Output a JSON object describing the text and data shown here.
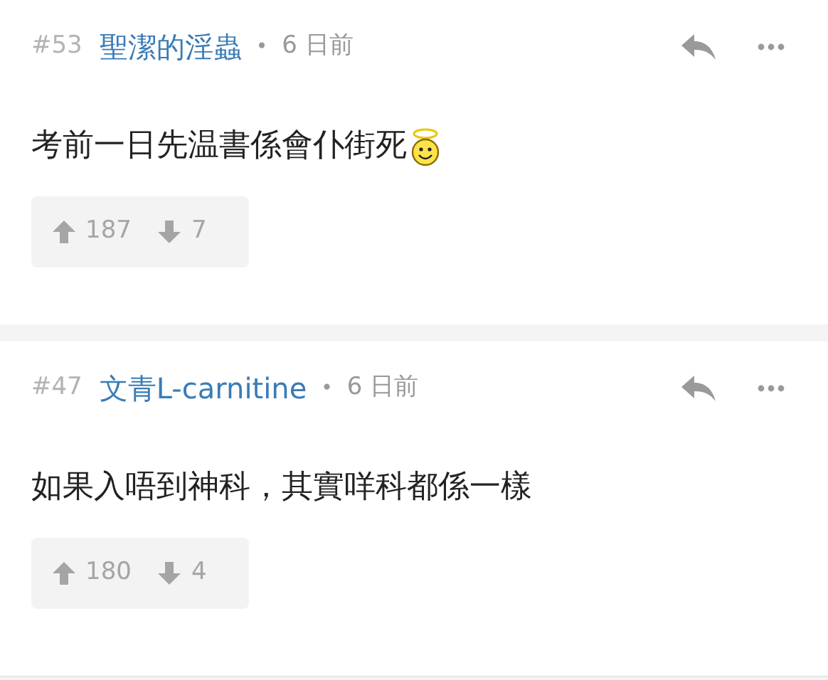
{
  "comments": [
    {
      "number": "#53",
      "author": "聖潔的淫蟲",
      "separator": "•",
      "time": "6 日前",
      "text": "考前一日先温書係會仆街死",
      "emoji": true,
      "upvotes": "187",
      "downvotes": "7"
    },
    {
      "number": "#47",
      "author": "文青L-carnitine",
      "separator": "•",
      "time": "6 日前",
      "text": "如果入唔到神科，其實咩科都係一樣",
      "emoji": false,
      "upvotes": "180",
      "downvotes": "4"
    }
  ]
}
